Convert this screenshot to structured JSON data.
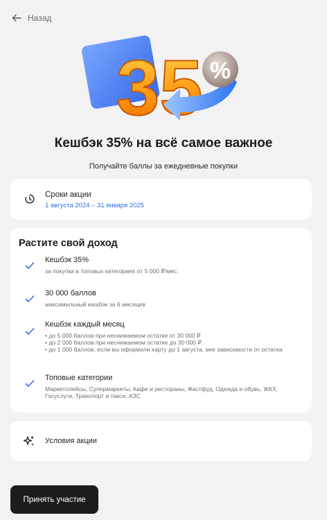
{
  "nav": {
    "back_label": "Назад"
  },
  "hero": {
    "number": "35",
    "percent_sign": "%"
  },
  "promo": {
    "title": "Кешбэк 35% на всё самое важное",
    "subtitle": "Получайте баллы за ежедневные покупки"
  },
  "period": {
    "label": "Сроки акции",
    "dates": "1 августа 2024 – 31 января 2025"
  },
  "income": {
    "heading": "Растите свой доход",
    "items": [
      {
        "title": "Кешбэк 35%",
        "lines": [
          "за покупки в топовых категориях от 5 000 ₽/мес."
        ]
      },
      {
        "title": "30 000 баллов",
        "lines": [
          "максимальный кешбэк за 6 месяцев"
        ]
      },
      {
        "title": "Кешбэк каждый месяц",
        "lines": [
          "• до 5 000 баллов при неснижаемом остатке от 30 000 ₽",
          "• до 2 000 баллов при неснижаемом остатке до 30 000 ₽",
          "• до 1 000 баллов, если вы оформили карту до 1 августа, вне зависимости от остатка"
        ]
      },
      {
        "title": "Топовые категории",
        "lines": [
          "Маркетплейсы, Супермаркеты, Кафе и рестораны, Фастфуд, Одежда и обувь, ЖКХ, Госуслуги, Транспорт и такси, АЗС"
        ]
      }
    ]
  },
  "terms": {
    "label": "Условия акции"
  },
  "cta": {
    "label": "Принять участие"
  },
  "colors": {
    "accent_blue": "#2d6cdf",
    "check_blue": "#2f6fe0",
    "button_dark": "#1c1c1f",
    "background": "#f2f2f3"
  }
}
